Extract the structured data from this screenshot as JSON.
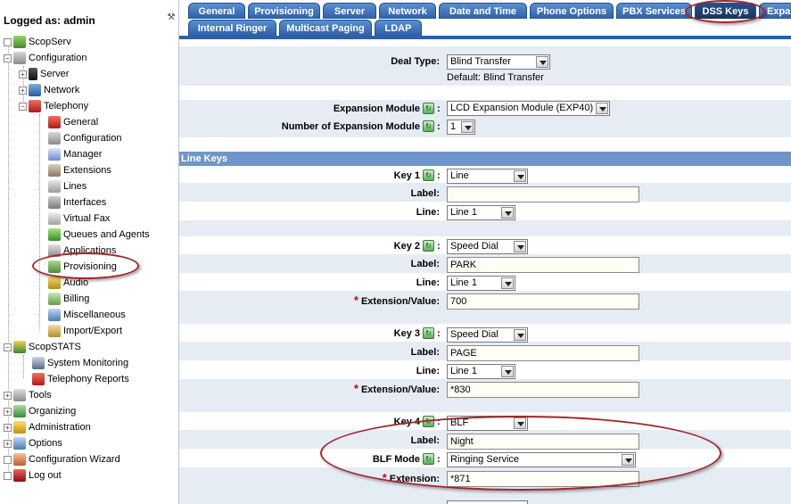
{
  "sidebar": {
    "logged_as": "Logged as: admin",
    "tree": {
      "scopserv": "ScopServ",
      "configuration": "Configuration",
      "server": "Server",
      "network": "Network",
      "telephony": "Telephony",
      "general": "General",
      "configuration_sub": "Configuration",
      "manager": "Manager",
      "extensions": "Extensions",
      "lines": "Lines",
      "interfaces": "Interfaces",
      "virtual_fax": "Virtual Fax",
      "queues_agents": "Queues and Agents",
      "applications": "Applications",
      "provisioning": "Provisioning",
      "audio": "Audio",
      "billing": "Billing",
      "miscellaneous": "Miscellaneous",
      "import_export": "Import/Export",
      "scopstats": "ScopSTATS",
      "system_monitoring": "System Monitoring",
      "telephony_reports": "Telephony Reports",
      "tools": "Tools",
      "organizing": "Organizing",
      "administration": "Administration",
      "options": "Options",
      "configuration_wizard": "Configuration Wizard",
      "log_out": "Log out"
    }
  },
  "tabs": {
    "row1": [
      "General",
      "Provisioning",
      "Server",
      "Network",
      "Date and Time",
      "Phone Options",
      "PBX Services",
      "DSS Keys",
      "Expa"
    ],
    "row2": [
      "Internal Ringer",
      "Multicast Paging",
      "LDAP"
    ],
    "active": "DSS Keys"
  },
  "form": {
    "deal_type_label": "Deal Type:",
    "deal_type_value": "Blind Transfer",
    "deal_type_default": "Default: Blind Transfer",
    "expansion_module_label": "Expansion Module",
    "expansion_module_value": "LCD Expansion Module (EXP40)",
    "num_expansion_label": "Number of Expansion Module",
    "num_expansion_value": "1",
    "colon": ":",
    "section_line_keys": "Line Keys",
    "label_label": "Label:",
    "line_label": "Line:",
    "extension_value_label": "Extension/Value:",
    "blf_mode_label": "BLF Mode",
    "extension_label": "Extension:",
    "key1": {
      "title": "Key 1",
      "type": "Line",
      "label": "",
      "line": "Line 1"
    },
    "key2": {
      "title": "Key 2",
      "type": "Speed Dial",
      "label": "PARK",
      "line": "Line 1",
      "value": "700"
    },
    "key3": {
      "title": "Key 3",
      "type": "Speed Dial",
      "label": "PAGE",
      "line": "Line 1",
      "value": "*830"
    },
    "key4": {
      "title": "Key 4",
      "type": "BLF",
      "label": "Night",
      "blf_mode": "Ringing Service",
      "extension": "*871"
    }
  },
  "colors": {
    "tab_blue": "#2d5fa6",
    "tab_active": "#17345f",
    "section_header": "#6f96c6",
    "row_alt": "#e6ecf4",
    "annotation_red": "#a0282a",
    "required_star": "#b01010"
  }
}
